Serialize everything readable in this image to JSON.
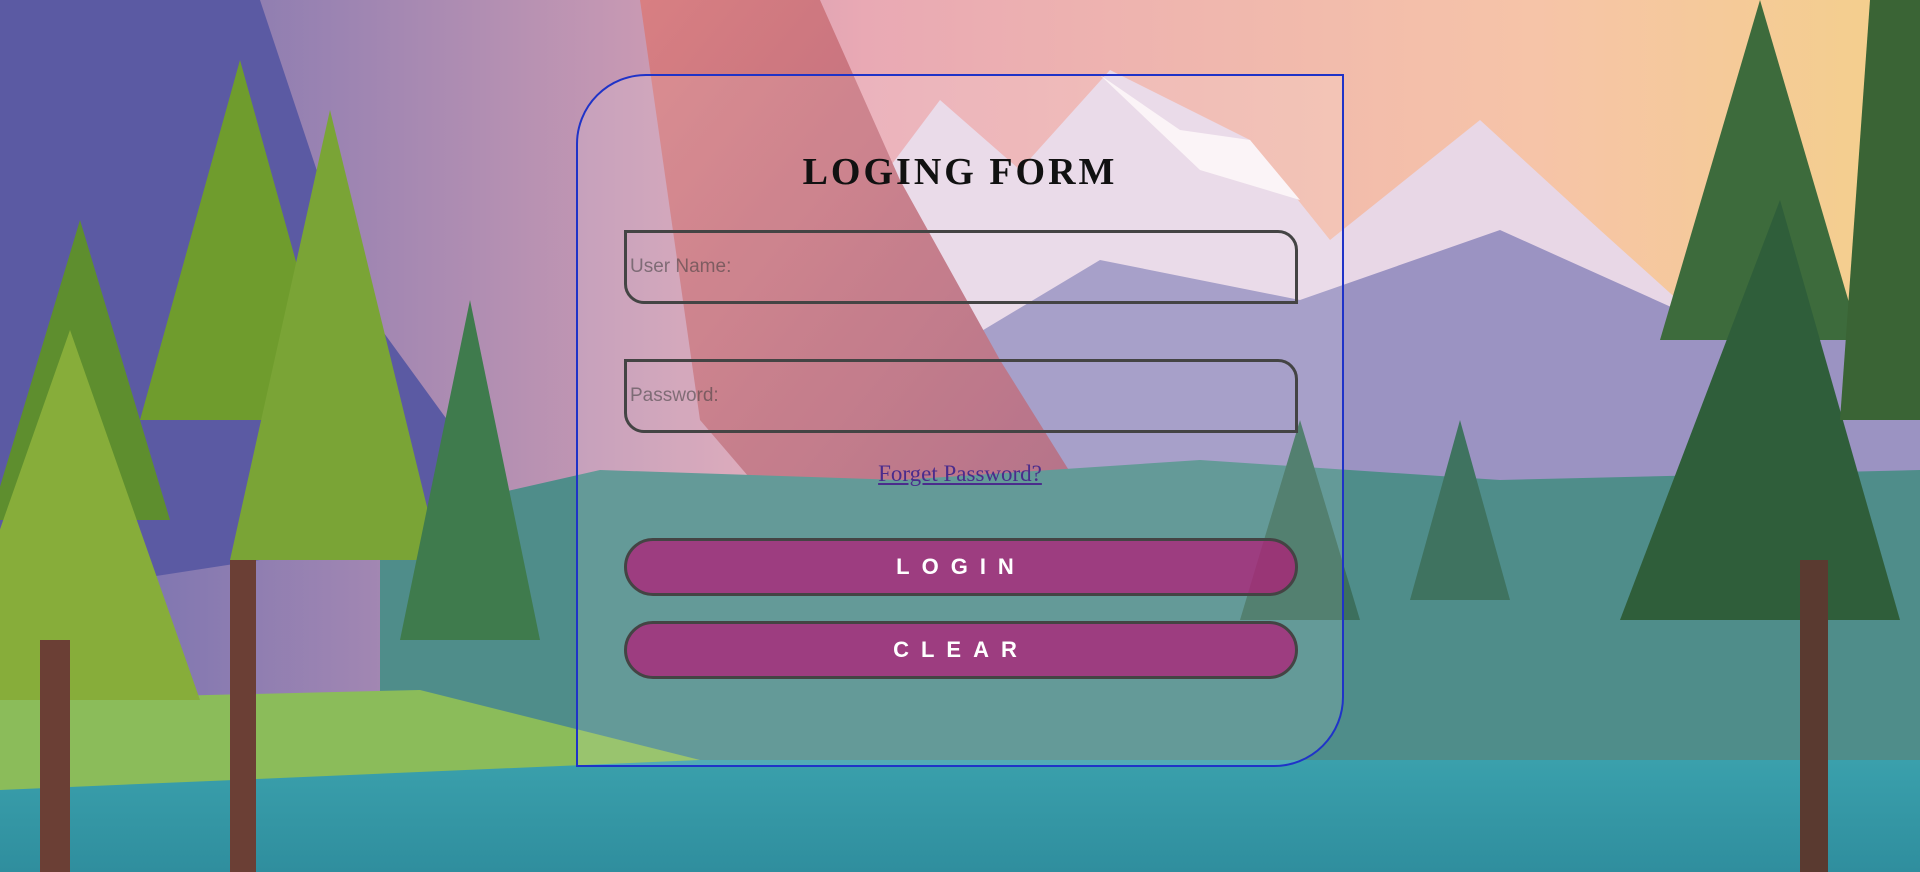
{
  "form": {
    "title": "LOGING FORM",
    "username_placeholder": "User Name:",
    "password_placeholder": "Password:",
    "forget_link": "Forget Password?",
    "login_label": "LOGIN",
    "clear_label": "CLEAR"
  },
  "colors": {
    "card_border": "#1f33c8",
    "button_bg": "#b01e78",
    "link": "#4a2c8c"
  }
}
